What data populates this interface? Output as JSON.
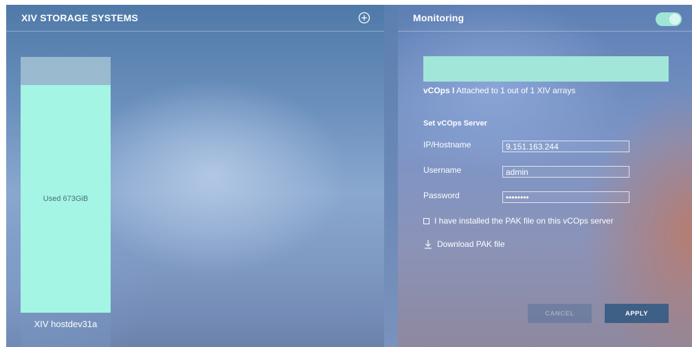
{
  "left_panel": {
    "title": "XIV STORAGE SYSTEMS",
    "add_icon": "plus-circle-icon",
    "storage": {
      "used_label": "Used 673GiB",
      "used_fraction": 0.89,
      "array_name": "XIV hostdev31a"
    }
  },
  "right_panel": {
    "title": "Monitoring",
    "toggle_on": true,
    "attach_bold": "vCOps I",
    "attach_text": " Attached to 1 out of 1 XIV arrays",
    "section_title": "Set vCOps Server",
    "fields": {
      "ip_label": "IP/Hostname",
      "ip_value": "9.151.163.244",
      "username_label": "Username",
      "username_value": "admin",
      "password_label": "Password",
      "password_value": "********"
    },
    "pak_checkbox_label": "I have installed the PAK file on this vCOps server",
    "pak_checked": false,
    "download_label": "Download PAK file",
    "download_icon": "download-arrow-icon",
    "cancel_label": "CANCEL",
    "apply_label": "APPLY"
  },
  "colors": {
    "accent": "#a4f5e4",
    "apply_button": "#3e5f86"
  }
}
